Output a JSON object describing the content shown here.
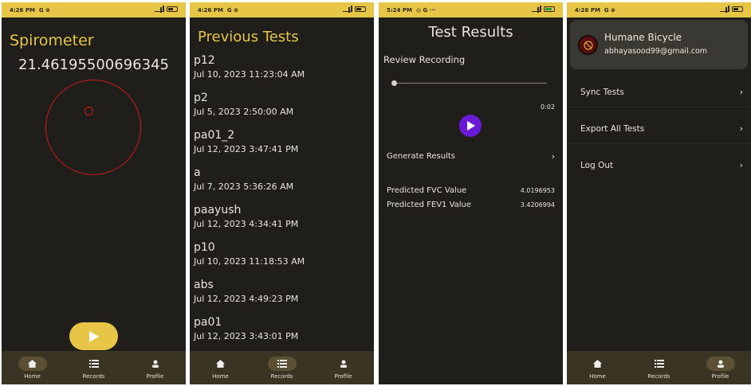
{
  "statusbars": [
    {
      "time": "4:26 PM",
      "icons": "G ⊚"
    },
    {
      "time": "4:26 PM",
      "icons": "G ⊚"
    },
    {
      "time": "5:24 PM",
      "icons": "◎ G ···"
    },
    {
      "time": "4:26 PM",
      "icons": "G ⊚"
    }
  ],
  "nav": {
    "home": "Home",
    "records": "Records",
    "profile": "Profile"
  },
  "home": {
    "title": "Spirometer",
    "value": "21.46195500696345"
  },
  "records": {
    "title": "Previous Tests",
    "tests": [
      {
        "name": "p12",
        "date": "Jul 10, 2023 11:23:04 AM"
      },
      {
        "name": "p2",
        "date": "Jul 5, 2023 2:50:00 AM"
      },
      {
        "name": "pa01_2",
        "date": "Jul 12, 2023 3:47:41 PM"
      },
      {
        "name": "a",
        "date": "Jul 7, 2023 5:36:26 AM"
      },
      {
        "name": "paayush",
        "date": "Jul 12, 2023 4:34:41 PM"
      },
      {
        "name": "p10",
        "date": "Jul 10, 2023 11:18:53 AM"
      },
      {
        "name": "abs",
        "date": "Jul 12, 2023 4:49:23 PM"
      },
      {
        "name": "pa01",
        "date": "Jul 12, 2023 3:43:01 PM"
      }
    ]
  },
  "results": {
    "title": "Test Results",
    "review_label": "Review Recording",
    "duration": "0:02",
    "playback_progress": 0,
    "generate_label": "Generate Results",
    "fvc_label": "Predicted FVC Value",
    "fvc_value": "4.0196953",
    "fev1_label": "Predicted FEV1 Value",
    "fev1_value": "3.4206994"
  },
  "profile": {
    "name": "Humane Bicycle",
    "email": "abhayasood99@gmail.com",
    "menu": [
      "Sync Tests",
      "Export All Tests",
      "Log Out"
    ]
  },
  "colors": {
    "accent": "#e6c547",
    "background": "#1f1e1a",
    "nav": "#3a3425",
    "play_purple": "#6a1ad6",
    "circle_red": "#d11a1a"
  }
}
